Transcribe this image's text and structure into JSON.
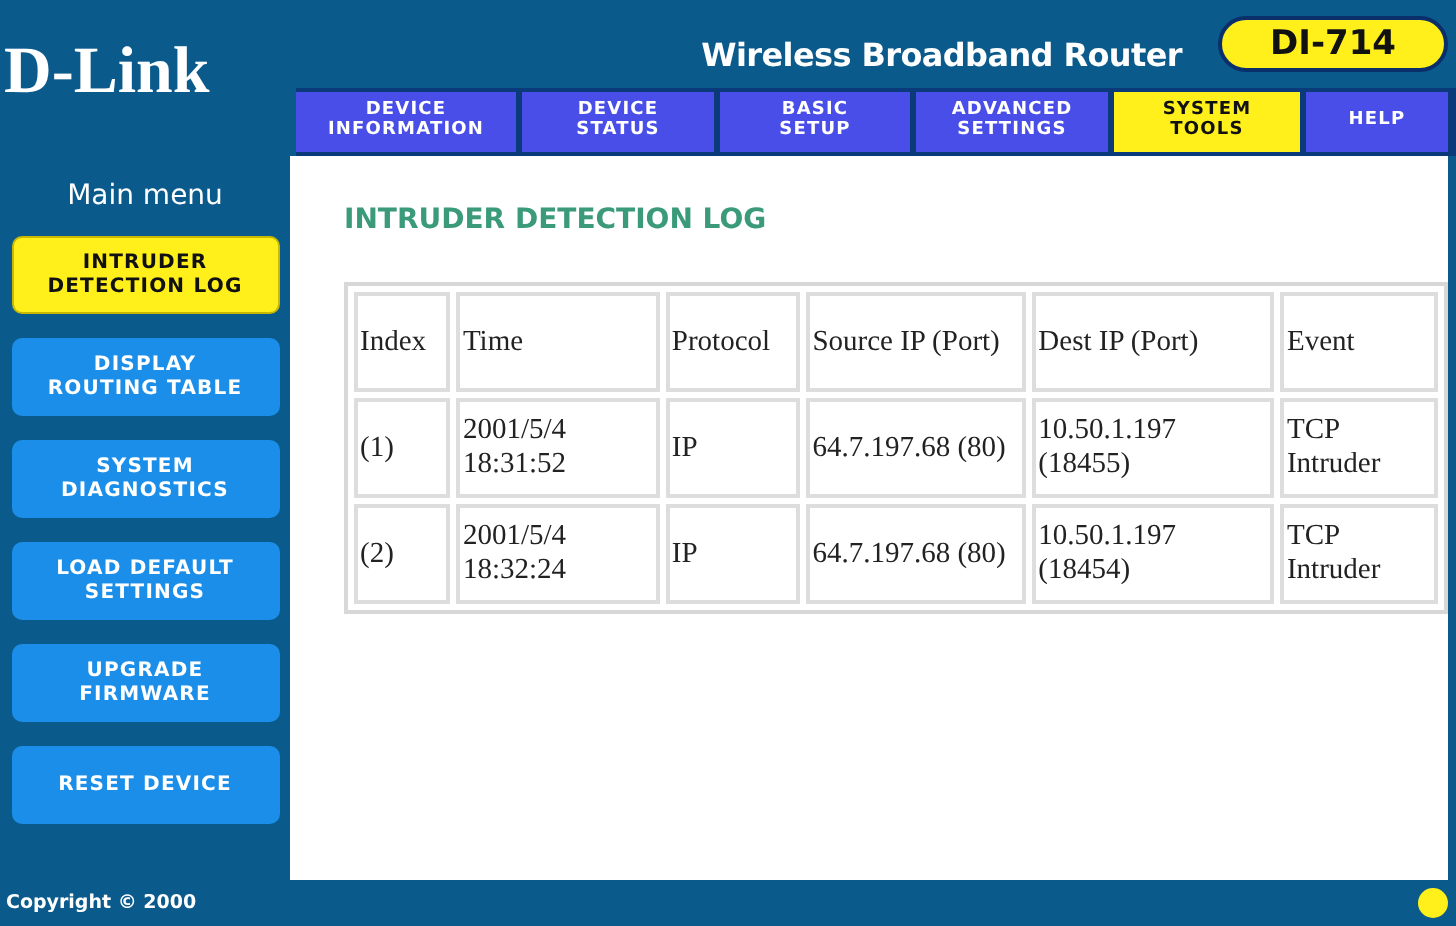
{
  "logo": "D-Link",
  "product_title": "Wireless Broadband Router",
  "model_badge": "DI-714",
  "tabs": [
    {
      "label": "DEVICE\nINFORMATION",
      "selected": false
    },
    {
      "label": "DEVICE\nSTATUS",
      "selected": false
    },
    {
      "label": "BASIC\nSETUP",
      "selected": false
    },
    {
      "label": "ADVANCED\nSETTINGS",
      "selected": false
    },
    {
      "label": "SYSTEM\nTOOLS",
      "selected": true
    },
    {
      "label": "HELP",
      "selected": false
    }
  ],
  "sidebar": {
    "title": "Main menu",
    "items": [
      {
        "label": "INTRUDER\nDETECTION LOG",
        "selected": true
      },
      {
        "label": "DISPLAY\nROUTING TABLE",
        "selected": false
      },
      {
        "label": "SYSTEM\nDIAGNOSTICS",
        "selected": false
      },
      {
        "label": "LOAD DEFAULT\nSETTINGS",
        "selected": false
      },
      {
        "label": "UPGRADE\nFIRMWARE",
        "selected": false
      },
      {
        "label": "RESET DEVICE",
        "selected": false
      }
    ]
  },
  "page_title": "INTRUDER DETECTION LOG",
  "table": {
    "columns": [
      "Index",
      "Time",
      "Protocol",
      "Source IP (Port)",
      "Dest IP (Port)",
      "Event"
    ],
    "rows": [
      [
        "(1)",
        "2001/5/4 18:31:52",
        "IP",
        "64.7.197.68 (80)",
        "10.50.1.197 (18455)",
        "TCP Intruder"
      ],
      [
        "(2)",
        "2001/5/4 18:32:24",
        "IP",
        "64.7.197.68 (80)",
        "10.50.1.197 (18454)",
        "TCP Intruder"
      ]
    ]
  },
  "status_bar": {
    "copyright": "Copyright © 2000"
  }
}
